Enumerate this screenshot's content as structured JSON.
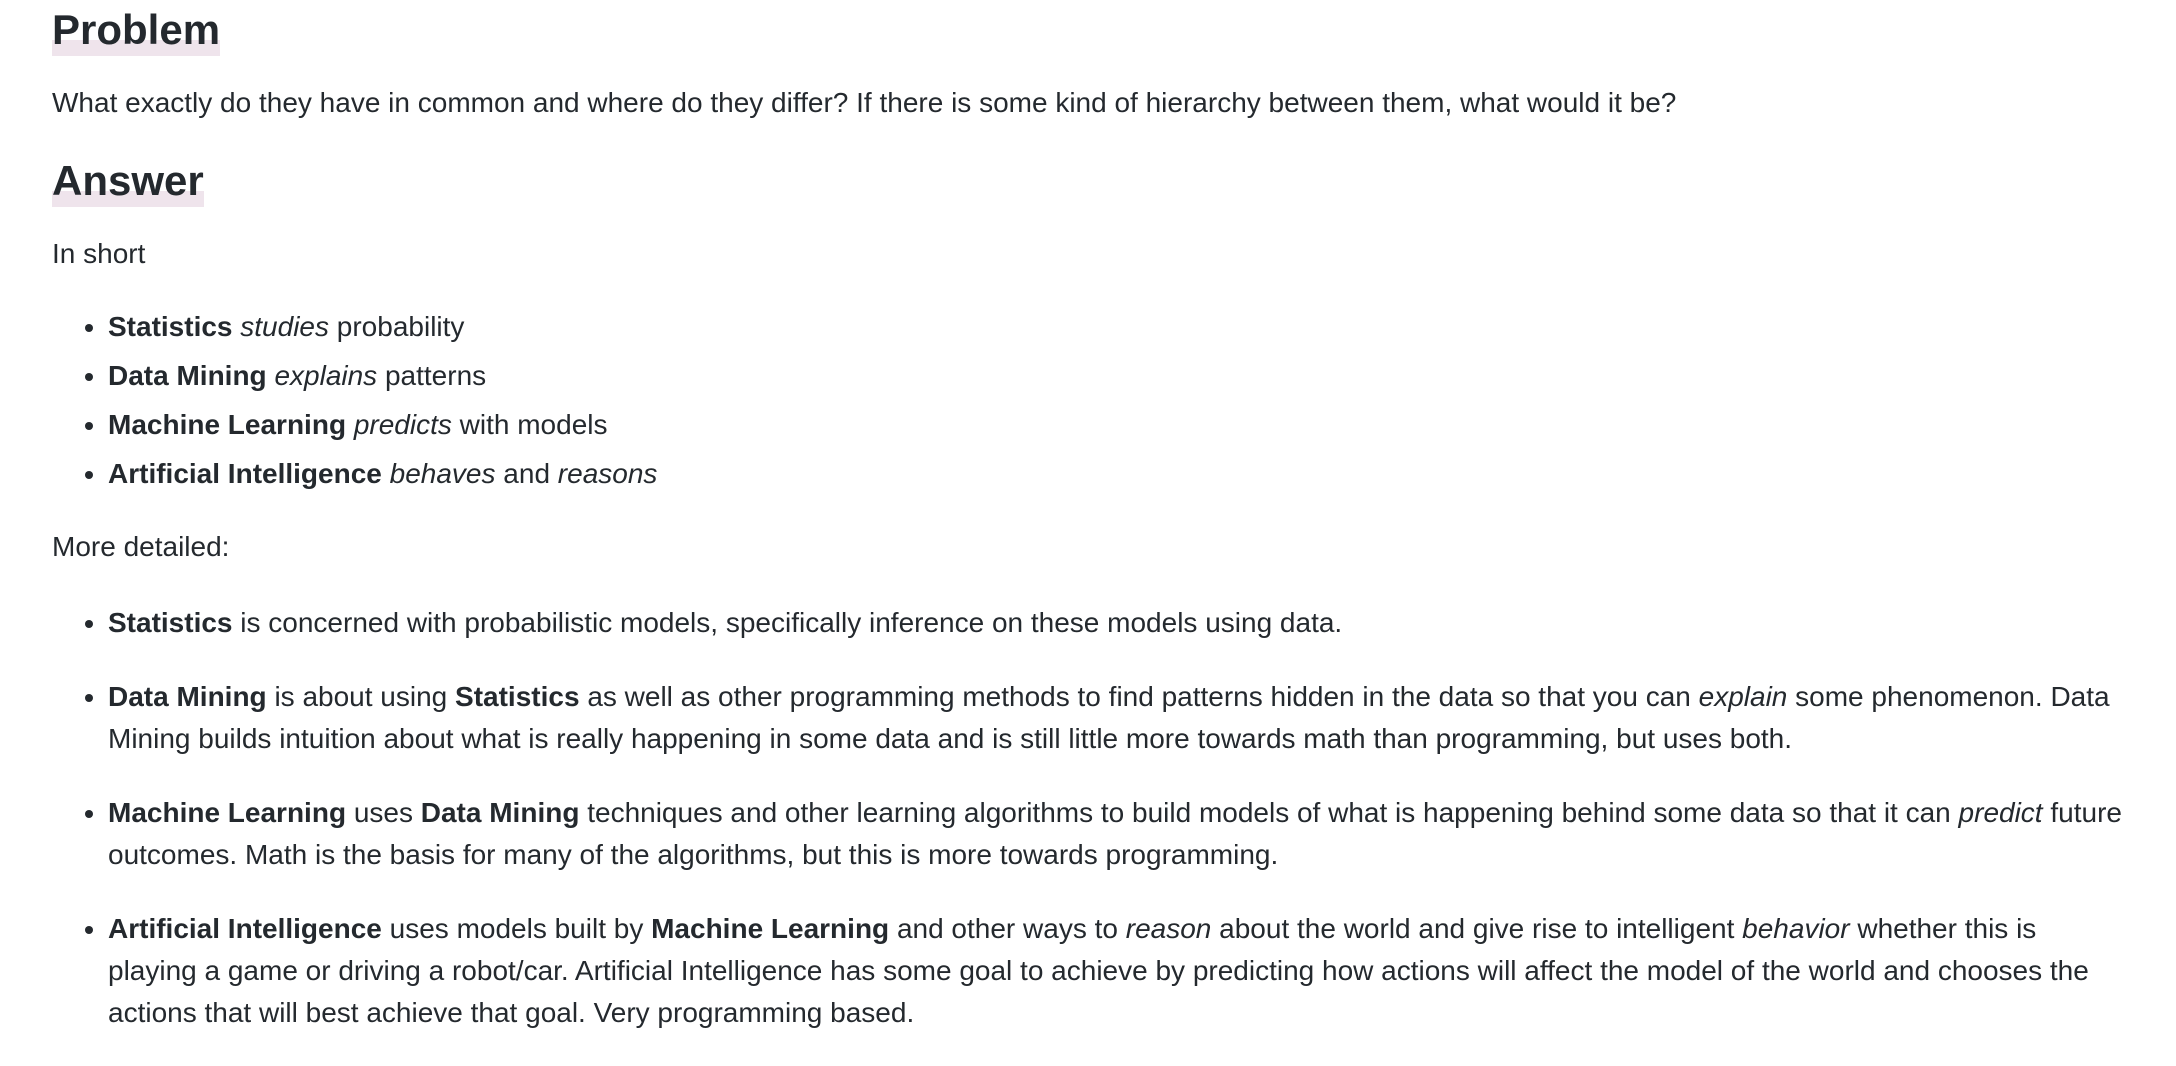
{
  "problem": {
    "heading": "Problem",
    "question": "What exactly do they have in common and where do they differ? If there is some kind of hierarchy between them, what would it be?"
  },
  "answer": {
    "heading": "Answer",
    "in_short_label": "In short",
    "short_items": [
      {
        "term": "Statistics",
        "verb": "studies",
        "rest": "probability"
      },
      {
        "term": "Data Mining",
        "verb": "explains",
        "rest": "patterns"
      },
      {
        "term": "Machine Learning",
        "verb": "predicts",
        "rest": "with models"
      },
      {
        "term": "Artificial Intelligence",
        "verb": "behaves",
        "and": "and",
        "verb2": "reasons"
      }
    ],
    "more_detailed_label": "More detailed:",
    "detailed_items": [
      {
        "term": "Statistics",
        "text": "is concerned with probabilistic models, specifically inference on these models using data."
      },
      {
        "term": "Data Mining",
        "t1": "is about using",
        "term2": "Statistics",
        "t2": "as well as other programming methods to find patterns hidden in the data so that you can",
        "em": "explain",
        "t3": "some phenomenon. Data Mining builds intuition about what is really happening in some data and is still little more towards math than programming, but uses both."
      },
      {
        "term": "Machine Learning",
        "t1": "uses",
        "term2": "Data Mining",
        "t2": "techniques and other learning algorithms to build models of what is happening behind some data so that it can",
        "em": "predict",
        "t3": "future outcomes. Math is the basis for many of the algorithms, but this is more towards programming."
      },
      {
        "term": "Artificial Intelligence",
        "t1": "uses models built by",
        "term2": "Machine Learning",
        "t2": "and other ways to",
        "em": "reason",
        "t3": "about the world and give rise to intelligent",
        "em2": "behavior",
        "t4": "whether this is playing a game or driving a robot/car. Artificial Intelligence has some goal to achieve by predicting how actions will affect the model of the world and chooses the actions that will best achieve that goal. Very programming based."
      }
    ]
  }
}
